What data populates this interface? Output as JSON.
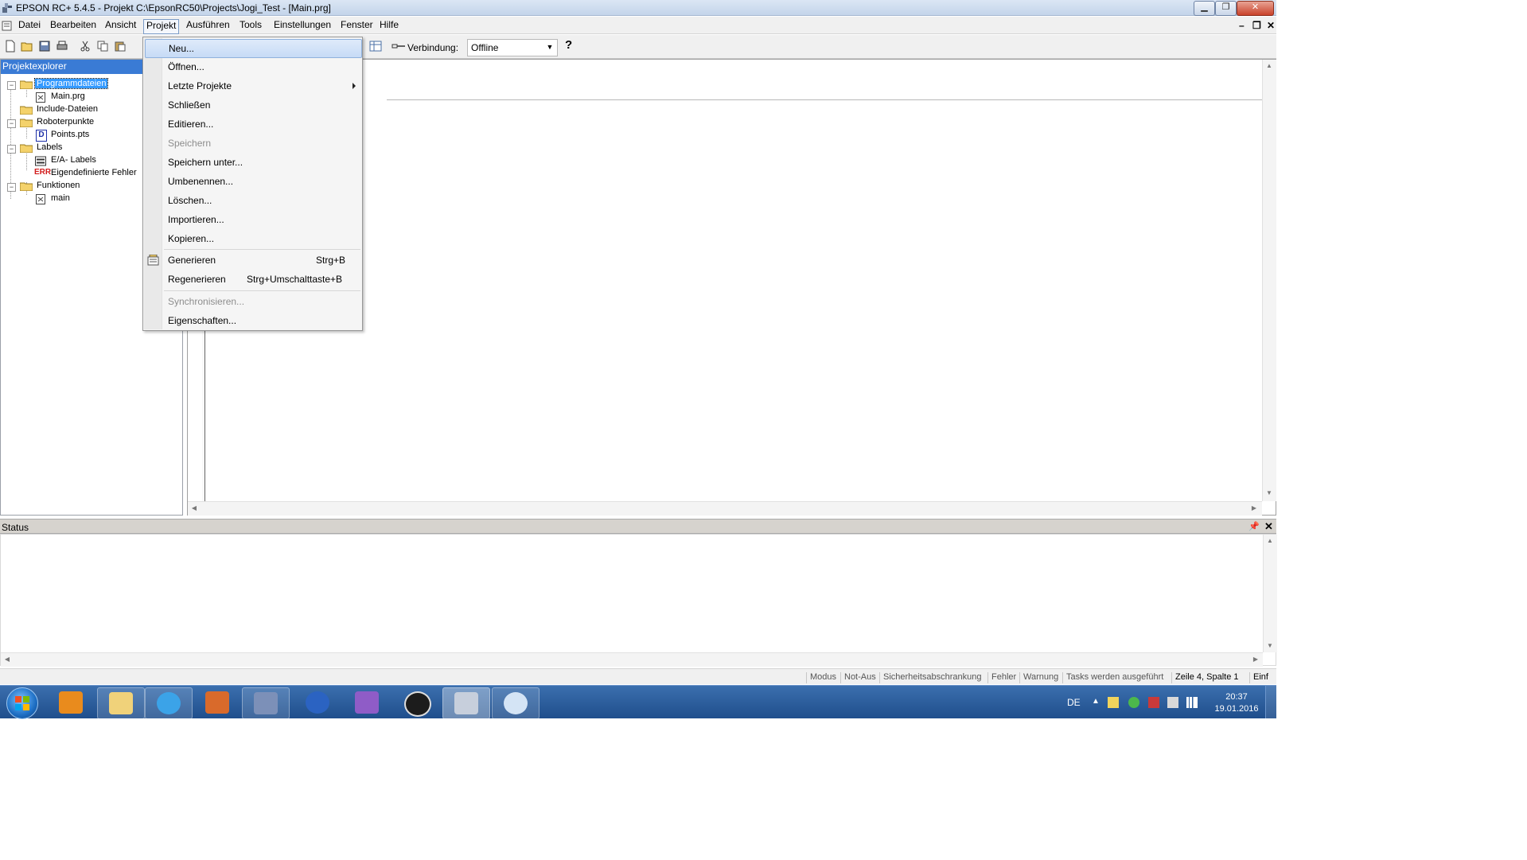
{
  "window": {
    "title": "EPSON RC+ 5.4.5 - Projekt C:\\EpsonRC50\\Projects\\Jogi_Test  - [Main.prg]"
  },
  "menubar": {
    "items": [
      "Datei",
      "Bearbeiten",
      "Ansicht",
      "Projekt",
      "Ausführen",
      "Tools",
      "Einstellungen",
      "Fenster",
      "Hilfe"
    ],
    "active": "Projekt"
  },
  "toolbar": {
    "connection_label": "Verbindung:",
    "connection_value": "Offline",
    "help_label": "?"
  },
  "explorer": {
    "title": "Projektexplorer",
    "nodes": {
      "programmdateien": "Programmdateien",
      "main_prg": "Main.prg",
      "include_dateien": "Include-Dateien",
      "roboterpunkte": "Roboterpunkte",
      "points_pts": "Points.pts",
      "labels": "Labels",
      "ea_labels": "E/A- Labels",
      "eigendefinierte_fehler": "Eigendefinierte Fehler",
      "funktionen": "Funktionen",
      "main": "main"
    },
    "icons": {
      "err": "ERR",
      "pts": "D"
    }
  },
  "dropdown": {
    "neu": "Neu...",
    "oeffnen": "Öffnen...",
    "letzte_projekte": "Letzte Projekte",
    "schliessen": "Schließen",
    "editieren": "Editieren...",
    "speichern": "Speichern",
    "speichern_unter": "Speichern unter...",
    "umbenennen": "Umbenennen...",
    "loeschen": "Löschen...",
    "importieren": "Importieren...",
    "kopieren": "Kopieren...",
    "generieren": "Generieren",
    "generieren_shortcut": "Strg+B",
    "regenerieren": "Regenerieren",
    "regenerieren_shortcut": "Strg+Umschalttaste+B",
    "synchronisieren": "Synchronisieren...",
    "eigenschaften": "Eigenschaften..."
  },
  "status_panel": {
    "title": "Status"
  },
  "statusbar": {
    "cells": [
      "Modus",
      "Not-Aus",
      "Sicherheitsabschrankung",
      "Fehler",
      "Warnung",
      "Tasks werden ausgeführt"
    ],
    "position": "Zeile 4, Spalte 1",
    "mode": "Einf"
  },
  "taskbar": {
    "apps": [
      "outlook-icon",
      "explorer-icon",
      "internet-explorer-icon",
      "vmware-icon",
      "virtualbox-icon",
      "skype-icon",
      "onenote-icon",
      "keepass-icon",
      "epson-rc-icon",
      "paint-icon"
    ],
    "language": "DE",
    "time": "20:37",
    "date": "19.01.2016"
  },
  "colors": {
    "selection": "#3399ff",
    "explorer_header": "#3a7bd5",
    "taskbar": "#1f4e8c"
  }
}
